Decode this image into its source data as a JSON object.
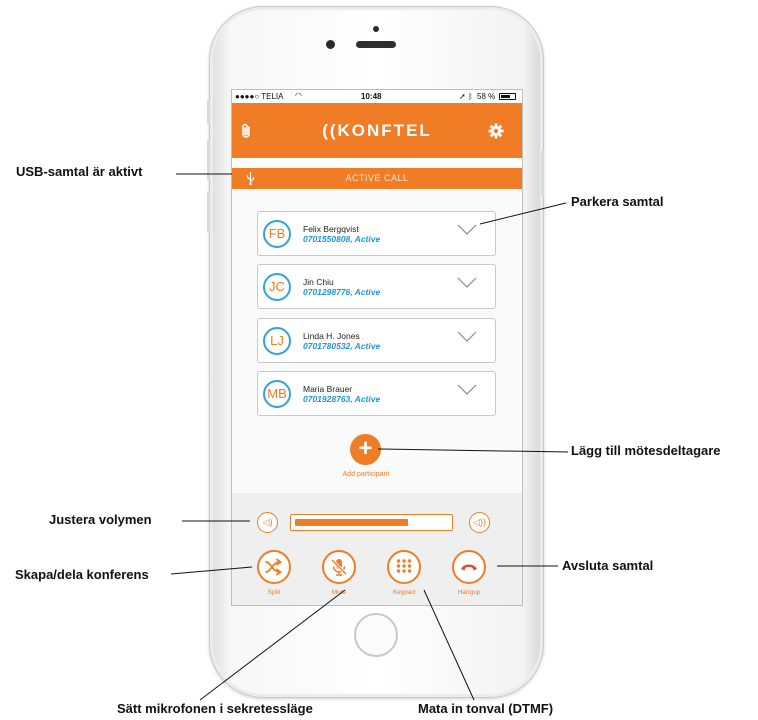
{
  "status_bar": {
    "carrier": "●●●●○ TELIA",
    "time": "10:48",
    "battery": "58 %"
  },
  "app": {
    "brand": "((KONFTEL",
    "active_call_label": "ACTIVE CALL"
  },
  "participants": [
    {
      "initials": "FB",
      "name": "Felix Bergqvist",
      "detail": "0701550808, Active"
    },
    {
      "initials": "JC",
      "name": "Jin Chiu",
      "detail": "0701298776, Active"
    },
    {
      "initials": "LJ",
      "name": "Linda H. Jones",
      "detail": "0701780532, Active"
    },
    {
      "initials": "MB",
      "name": "Maria Brauer",
      "detail": "0701928763, Active"
    }
  ],
  "add_participant_label": "Add participant",
  "volume": {
    "level_fraction": 0.74
  },
  "controls": {
    "split": "Split",
    "mute": "Mute",
    "keypad": "Keypad",
    "hangup": "Hangup"
  },
  "annotations": {
    "usb": "USB-samtal är aktivt",
    "park": "Parkera samtal",
    "add": "Lägg till mötesdeltagare",
    "volume": "Justera volymen",
    "split": "Skapa/dela konferens",
    "hangup": "Avsluta samtal",
    "mute": "Sätt mikrofonen i sekretessläge",
    "dtmf": "Mata in tonval (DTMF)"
  },
  "colors": {
    "accent": "#f07c26",
    "link": "#1f95d4",
    "avatar_ring": "#33a3dc"
  }
}
